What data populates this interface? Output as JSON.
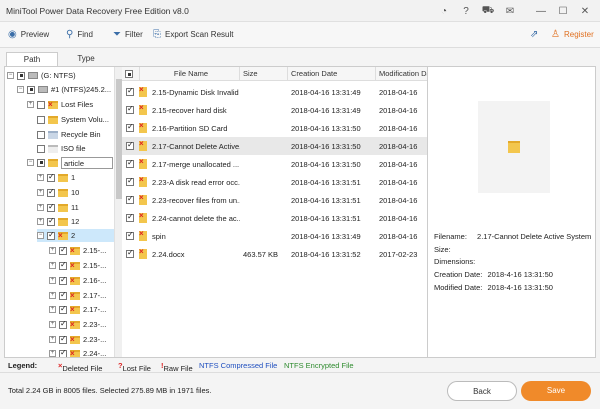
{
  "window": {
    "title": "MiniTool Power Data Recovery Free Edition v8.0",
    "icons": [
      "speedometer-icon",
      "help-icon",
      "cart-icon",
      "mail-icon",
      "minimize-icon",
      "maximize-icon",
      "close-icon"
    ]
  },
  "toolbar": {
    "preview": "Preview",
    "find": "Find",
    "filter": "Filter",
    "export": "Export Scan Result",
    "register": "Register"
  },
  "tabs": {
    "path": "Path",
    "type": "Type"
  },
  "tree": {
    "root": "(G: NTFS)",
    "partition": "#1 (NTFS)245.2...",
    "lost_files": "Lost Files",
    "system_volume": "System Volu...",
    "recycle_bin": "Recycle Bin",
    "iso_file": "ISO file",
    "article": "article",
    "n1": "1",
    "n10": "10",
    "n11": "11",
    "n12": "12",
    "n2": "2",
    "sub": [
      "2.15-...",
      "2.15-...",
      "2.16-...",
      "2.17-...",
      "2.17-...",
      "2.23-...",
      "2.23-...",
      "2.24-..."
    ]
  },
  "table": {
    "headers": {
      "name": "File Name",
      "size": "Size",
      "created": "Creation Date",
      "modified": "Modification Da"
    },
    "rows": [
      {
        "name": "2.15-Dynamic Disk Invalid",
        "size": "",
        "created": "2018-04-16 13:31:49",
        "modified": "2018-04-16"
      },
      {
        "name": "2.15-recover hard disk",
        "size": "",
        "created": "2018-04-16 13:31:49",
        "modified": "2018-04-16"
      },
      {
        "name": "2.16-Partition SD Card",
        "size": "",
        "created": "2018-04-16 13:31:50",
        "modified": "2018-04-16"
      },
      {
        "name": "2.17-Cannot Delete Active...",
        "size": "",
        "created": "2018-04-16 13:31:50",
        "modified": "2018-04-16"
      },
      {
        "name": "2.17-merge unallocated ...",
        "size": "",
        "created": "2018-04-16 13:31:50",
        "modified": "2018-04-16"
      },
      {
        "name": "2.23-A disk read error occ...",
        "size": "",
        "created": "2018-04-16 13:31:51",
        "modified": "2018-04-16"
      },
      {
        "name": "2.23-recover files from un...",
        "size": "",
        "created": "2018-04-16 13:31:51",
        "modified": "2018-04-16"
      },
      {
        "name": "2.24-cannot delete the ac...",
        "size": "",
        "created": "2018-04-16 13:31:51",
        "modified": "2018-04-16"
      },
      {
        "name": "spin",
        "size": "",
        "created": "2018-04-16 13:31:49",
        "modified": "2018-04-16"
      },
      {
        "name": "2.24.docx",
        "size": "463.57 KB",
        "created": "2018-04-16 13:31:52",
        "modified": "2017-02-23"
      }
    ]
  },
  "details": {
    "filename_label": "Filename:",
    "filename_value": "2.17-Cannot Delete Active System",
    "size_label": "Size:",
    "dimensions_label": "Dimensions:",
    "created_label": "Creation Date:",
    "created_value": "2018-4-16 13:31:50",
    "modified_label": "Modified Date:",
    "modified_value": "2018-4-16 13:31:50"
  },
  "legend": {
    "title": "Legend:",
    "deleted": "Deleted File",
    "lost": "Lost File",
    "raw": "Raw File",
    "compressed": "NTFS Compressed File",
    "encrypted": "NTFS Encrypted File"
  },
  "status": {
    "text": "Total 2.24 GB in 8005 files.  Selected 275.89 MB in 1971 files.",
    "back": "Back",
    "save": "Save"
  },
  "colors": {
    "accent": "#f08a2a",
    "compressed": "#1f4fbf",
    "encrypted": "#2e8b2e",
    "deleted": "#d22222"
  }
}
